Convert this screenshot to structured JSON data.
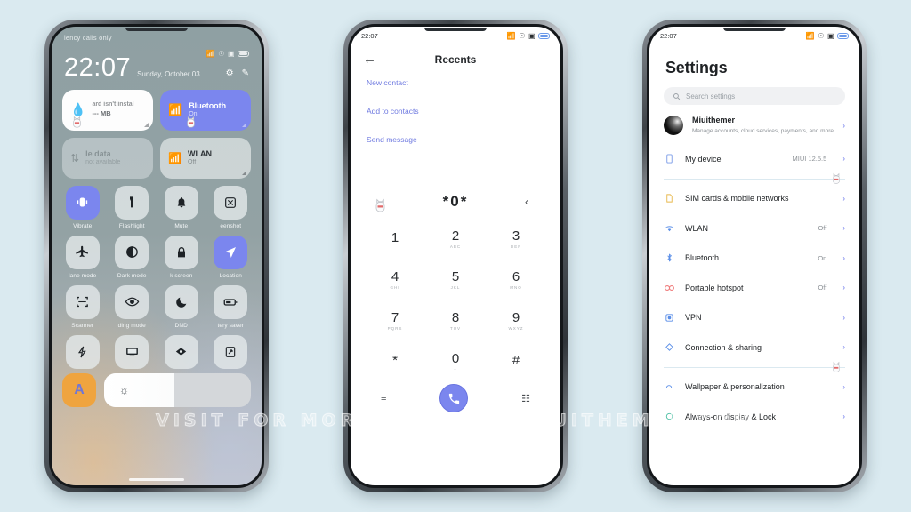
{
  "watermark": "VISIT FOR MORE THEMES - MIUITHEMER.COM",
  "phone1": {
    "status": {
      "time": "",
      "icons": [
        "bluetooth-icon",
        "alarm-icon",
        "screenshot-icon",
        "battery-icon"
      ]
    },
    "lockscreen": {
      "carrier": "iency calls only",
      "time": "22:07",
      "date": "Sunday, October 03",
      "settings_icon": "gear-icon",
      "edit_icon": "edit-icon"
    },
    "control_center": {
      "big_tiles": [
        {
          "title": "ard isn't instal",
          "sub": "--- MB",
          "state": "off",
          "icon": "data-drop-icon"
        },
        {
          "title": "Bluetooth",
          "sub": "On",
          "state": "on",
          "icon": "bluetooth-icon"
        },
        {
          "title": "le data",
          "sub": "not available",
          "state": "disabled",
          "icon": "mobile-data-icon"
        },
        {
          "title": "WLAN",
          "sub": "Off",
          "state": "off",
          "icon": "wifi-icon"
        }
      ],
      "toggles": [
        {
          "label": "Vibrate",
          "icon": "vibrate-icon",
          "state": "on"
        },
        {
          "label": "Flashlight",
          "icon": "flashlight-icon",
          "state": "off"
        },
        {
          "label": "Mute",
          "icon": "bell-icon",
          "state": "off"
        },
        {
          "label": "eenshot",
          "icon": "screenshot-icon",
          "state": "off"
        },
        {
          "label": "lane mode",
          "icon": "airplane-icon",
          "state": "off"
        },
        {
          "label": "Dark mode",
          "icon": "contrast-icon",
          "state": "off"
        },
        {
          "label": "k screen",
          "icon": "lock-icon",
          "state": "off"
        },
        {
          "label": "Location",
          "icon": "location-icon",
          "state": "on"
        },
        {
          "label": "Scanner",
          "icon": "scanner-icon",
          "state": "off"
        },
        {
          "label": "ding mode",
          "icon": "eye-icon",
          "state": "off"
        },
        {
          "label": "DND",
          "icon": "moon-icon",
          "state": "off"
        },
        {
          "label": "tery saver",
          "icon": "battery-icon",
          "state": "off"
        },
        {
          "label": "",
          "icon": "lightning-icon",
          "state": "off"
        },
        {
          "label": "",
          "icon": "cast-icon",
          "state": "off"
        },
        {
          "label": "",
          "icon": "reading-icon",
          "state": "off"
        },
        {
          "label": "",
          "icon": "rotate-icon",
          "state": "off"
        }
      ],
      "brightness": {
        "auto_label": "A",
        "icon": "sun-icon",
        "value_percent": 48
      }
    }
  },
  "phone2": {
    "status": {
      "time": "22:07",
      "icons": [
        "bluetooth-icon",
        "alarm-icon",
        "screenshot-icon",
        "battery-icon"
      ]
    },
    "header": {
      "back_icon": "arrow-left-icon",
      "title": "Recents"
    },
    "links": [
      "New contact",
      "Add to contacts",
      "Send message"
    ],
    "dialed_number": "*0*",
    "delete_icon": "backspace-icon",
    "keypad": [
      {
        "digit": "1",
        "letters": ""
      },
      {
        "digit": "2",
        "letters": "ABC"
      },
      {
        "digit": "3",
        "letters": "DEF"
      },
      {
        "digit": "4",
        "letters": "GHI"
      },
      {
        "digit": "5",
        "letters": "JKL"
      },
      {
        "digit": "6",
        "letters": "MNO"
      },
      {
        "digit": "7",
        "letters": "PQRS"
      },
      {
        "digit": "8",
        "letters": "TUV"
      },
      {
        "digit": "9",
        "letters": "WXYZ"
      },
      {
        "digit": "*",
        "letters": ""
      },
      {
        "digit": "0",
        "letters": "+"
      },
      {
        "digit": "#",
        "letters": ""
      }
    ],
    "bottom": {
      "left_icon": "menu-icon",
      "call_icon": "phone-icon",
      "right_icon": "keypad-icon"
    }
  },
  "phone3": {
    "status": {
      "time": "22:07",
      "icons": [
        "bluetooth-icon",
        "alarm-icon",
        "screenshot-icon",
        "battery-icon"
      ]
    },
    "title": "Settings",
    "search": {
      "icon": "search-icon",
      "placeholder": "Search settings"
    },
    "account": {
      "name": "Miuithemer",
      "subtitle": "Manage accounts, cloud services, payments, and more",
      "avatar": "avatar-icon"
    },
    "rows": [
      {
        "label": "My device",
        "value": "MIUI 12.5.5",
        "icon": "device-icon",
        "color": "#7b9ce8"
      },
      {
        "label": "SIM cards & mobile networks",
        "value": "",
        "icon": "sim-icon",
        "color": "#e8b84b"
      },
      {
        "label": "WLAN",
        "value": "Off",
        "icon": "wifi-icon",
        "color": "#5a8ee8"
      },
      {
        "label": "Bluetooth",
        "value": "On",
        "icon": "bluetooth-icon",
        "color": "#5a8ee8"
      },
      {
        "label": "Portable hotspot",
        "value": "Off",
        "icon": "hotspot-icon",
        "color": "#ef7b7b"
      },
      {
        "label": "VPN",
        "value": "",
        "icon": "vpn-icon",
        "color": "#5a8ee8"
      },
      {
        "label": "Connection & sharing",
        "value": "",
        "icon": "sharing-icon",
        "color": "#5a8ee8"
      },
      {
        "label": "Wallpaper & personalization",
        "value": "",
        "icon": "wallpaper-icon",
        "color": "#5a8ee8"
      },
      {
        "label": "Always-on display & Lock",
        "value": "",
        "icon": "aod-icon",
        "color": "#4fc0a5"
      }
    ]
  }
}
